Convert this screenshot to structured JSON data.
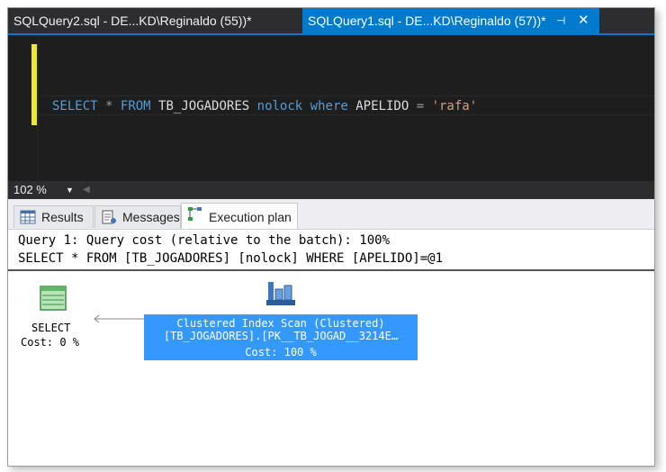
{
  "tabs": {
    "inactive_label": "SQLQuery2.sql - DE...KD\\Reginaldo (55))*",
    "active_label": "SQLQuery1.sql - DE...KD\\Reginaldo (57))*",
    "pin_glyph": "⊣",
    "close_glyph": "✕"
  },
  "editor": {
    "tokens": {
      "select": "SELECT",
      "star": "*",
      "from": "FROM",
      "table": "TB_JOGADORES",
      "nolock": "nolock",
      "where": "where",
      "column": "APELIDO",
      "equals": "=",
      "value": "'rafa'"
    }
  },
  "zoom": {
    "value": "102 %",
    "dropdown_glyph": "▼",
    "scroll_left_glyph": "◀"
  },
  "result_tabs": {
    "results": "Results",
    "messages": "Messages",
    "execution_plan": "Execution plan"
  },
  "plan": {
    "header_line1": "Query 1: Query cost (relative to the batch): 100%",
    "header_line2": "SELECT * FROM [TB_JOGADORES] [nolock] WHERE [APELIDO]=@1",
    "select_node": {
      "label": "SELECT",
      "cost": "Cost: 0 %"
    },
    "scan_node": {
      "title": "Clustered Index Scan (Clustered)",
      "object": "[TB_JOGADORES].[PK__TB_JOGAD__3214E…",
      "cost": "Cost: 100 %"
    }
  },
  "colors": {
    "accent": "#007acc",
    "editor_bg": "#1e1e1e",
    "selected_node": "#3399ff",
    "keyword": "#569cd6",
    "string": "#d69d85"
  }
}
